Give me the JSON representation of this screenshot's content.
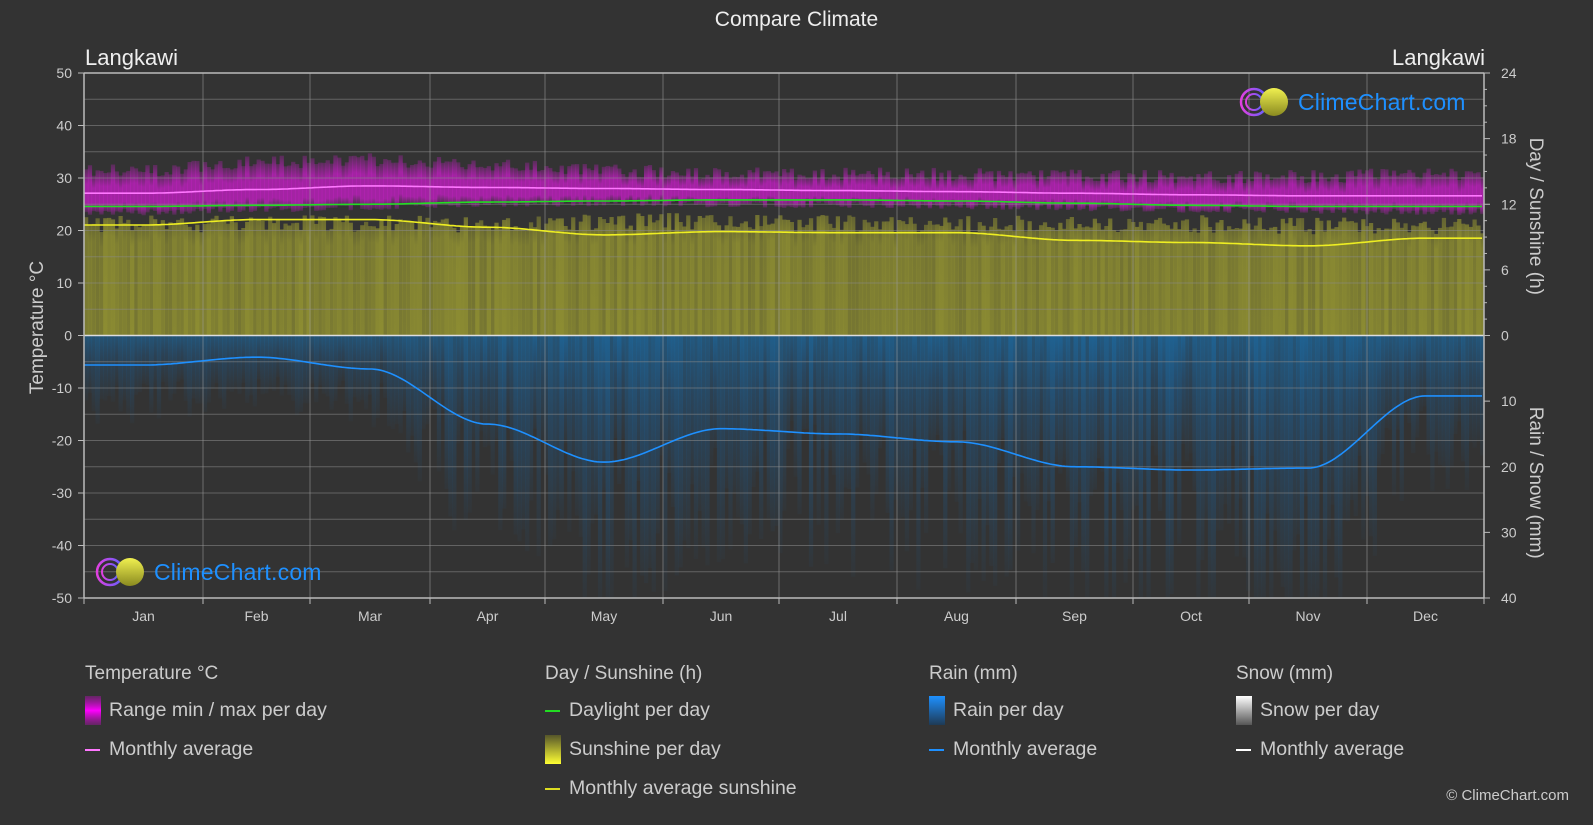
{
  "title": "Compare Climate",
  "location_left": "Langkawi",
  "location_right": "Langkawi",
  "logo_text": "ClimeChart.com",
  "copyright": "© ClimeChart.com",
  "colors": {
    "background": "#333333",
    "temp_range": "#c81ec8",
    "temp_avg": "#ff77ff",
    "daylight": "#22dd22",
    "sunshine_fill": "#8c8c32",
    "sunshine_avg": "#eeee22",
    "rain_fill": "#1e5a8c",
    "rain_avg": "#1e90ff",
    "snow_avg": "#ffffff",
    "grid": "#6a6a6a",
    "logo_blue": "#1e90ff"
  },
  "legend": {
    "temperature": {
      "title": "Temperature °C",
      "items": [
        {
          "label": "Range min / max per day",
          "swatch": "box-magenta"
        },
        {
          "label": "Monthly average",
          "swatch": "line-pink"
        }
      ]
    },
    "sunshine": {
      "title": "Day / Sunshine (h)",
      "items": [
        {
          "label": "Daylight per day",
          "swatch": "line-green"
        },
        {
          "label": "Sunshine per day",
          "swatch": "box-yellow"
        },
        {
          "label": "Monthly average sunshine",
          "swatch": "line-yellow"
        }
      ]
    },
    "rain": {
      "title": "Rain (mm)",
      "items": [
        {
          "label": "Rain per day",
          "swatch": "box-blue"
        },
        {
          "label": "Monthly average",
          "swatch": "line-blue"
        }
      ]
    },
    "snow": {
      "title": "Snow (mm)",
      "items": [
        {
          "label": "Snow per day",
          "swatch": "box-white"
        },
        {
          "label": "Monthly average",
          "swatch": "line-white"
        }
      ]
    }
  },
  "chart_data": {
    "type": "line",
    "title": "Compare Climate",
    "categories": [
      "Jan",
      "Feb",
      "Mar",
      "Apr",
      "May",
      "Jun",
      "Jul",
      "Aug",
      "Sep",
      "Oct",
      "Nov",
      "Dec"
    ],
    "left_axis": {
      "label": "Temperature °C",
      "ylim": [
        -50,
        50
      ],
      "ticks": [
        50,
        40,
        30,
        20,
        10,
        0,
        -10,
        -20,
        -30,
        -40,
        -50
      ]
    },
    "right_axis_top": {
      "label": "Day / Sunshine (h)",
      "ylim": [
        0,
        24
      ],
      "ticks": [
        24,
        18,
        12,
        6,
        0
      ]
    },
    "right_axis_bottom": {
      "label": "Rain / Snow (mm)",
      "ylim": [
        0,
        40
      ],
      "inverted": true,
      "ticks": [
        0,
        10,
        20,
        30,
        40
      ]
    },
    "grid": true,
    "series": [
      {
        "name": "Temperature monthly average",
        "axis": "temperature",
        "unit": "°C",
        "values": [
          27.1,
          27.8,
          28.5,
          28.2,
          28.0,
          27.8,
          27.6,
          27.4,
          27.1,
          26.8,
          26.6,
          26.6
        ]
      },
      {
        "name": "Temperature range min per day",
        "axis": "temperature",
        "unit": "°C",
        "values": [
          23.5,
          24.0,
          24.5,
          25.0,
          25.2,
          25.0,
          24.8,
          24.6,
          24.3,
          24.0,
          23.8,
          23.5
        ]
      },
      {
        "name": "Temperature range max per day",
        "axis": "temperature",
        "unit": "°C",
        "values": [
          31.0,
          32.5,
          33.0,
          32.0,
          31.0,
          30.5,
          30.3,
          30.2,
          30.0,
          29.8,
          29.8,
          30.2
        ]
      },
      {
        "name": "Daylight per day",
        "axis": "sunshine",
        "unit": "h",
        "values": [
          11.8,
          11.9,
          12.0,
          12.2,
          12.3,
          12.4,
          12.4,
          12.3,
          12.1,
          11.9,
          11.8,
          11.8
        ]
      },
      {
        "name": "Monthly average sunshine",
        "axis": "sunshine",
        "unit": "h",
        "values": [
          10.1,
          10.6,
          10.6,
          9.9,
          9.2,
          9.5,
          9.4,
          9.4,
          8.7,
          8.5,
          8.2,
          8.9
        ]
      },
      {
        "name": "Sunshine per day (top of band)",
        "axis": "sunshine",
        "unit": "h",
        "values": [
          11.0,
          11.0,
          11.0,
          11.0,
          11.2,
          11.2,
          11.0,
          11.0,
          11.0,
          11.0,
          10.8,
          10.8
        ]
      },
      {
        "name": "Rain monthly average",
        "axis": "rain",
        "unit": "mm",
        "values": [
          4.5,
          3.3,
          5.1,
          13.5,
          19.3,
          14.2,
          15.0,
          16.2,
          20.0,
          20.5,
          20.2,
          9.2
        ]
      },
      {
        "name": "Snow monthly average",
        "axis": "rain",
        "unit": "mm",
        "values": [
          0,
          0,
          0,
          0,
          0,
          0,
          0,
          0,
          0,
          0,
          0,
          0
        ]
      }
    ],
    "legend_position": "bottom"
  }
}
